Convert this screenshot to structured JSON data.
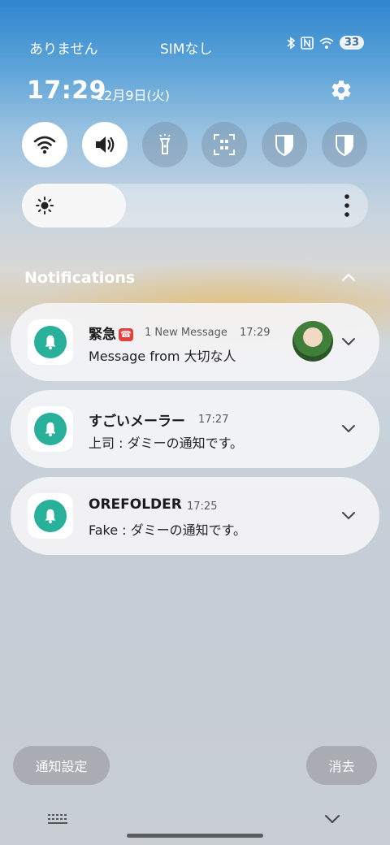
{
  "status_bar": {
    "carrier": "ありません",
    "sim": "SIMなし",
    "battery": "33",
    "icons": [
      "bluetooth-icon",
      "nfc-icon",
      "wifi-icon"
    ]
  },
  "header": {
    "time": "17:29",
    "date": "12月9日(火)"
  },
  "quick_toggles": [
    {
      "name": "wifi",
      "state": "on"
    },
    {
      "name": "sound",
      "state": "on"
    },
    {
      "name": "flashlight",
      "state": "off"
    },
    {
      "name": "qr-scanner",
      "state": "off"
    },
    {
      "name": "shield-1",
      "state": "off"
    },
    {
      "name": "shield-2",
      "state": "off"
    }
  ],
  "brightness": {
    "level": 0.3
  },
  "notifications": {
    "title": "Notifications",
    "items": [
      {
        "app": "緊急",
        "meta": "1 New Message",
        "time": "17:29",
        "body": "Message from 大切な人",
        "has_avatar": true
      },
      {
        "app": "すごいメーラー",
        "meta": "",
        "time": "17:27",
        "body": "上司 : ダミーの通知です。"
      },
      {
        "app": "OREFOLDER",
        "meta": "",
        "time": "17:25",
        "body": "Fake : ダミーの通知です。"
      }
    ]
  },
  "footer": {
    "settings_label": "通知設定",
    "clear_label": "消去"
  },
  "colors": {
    "accent": "#28b09b",
    "alarm": "#e4413c"
  }
}
